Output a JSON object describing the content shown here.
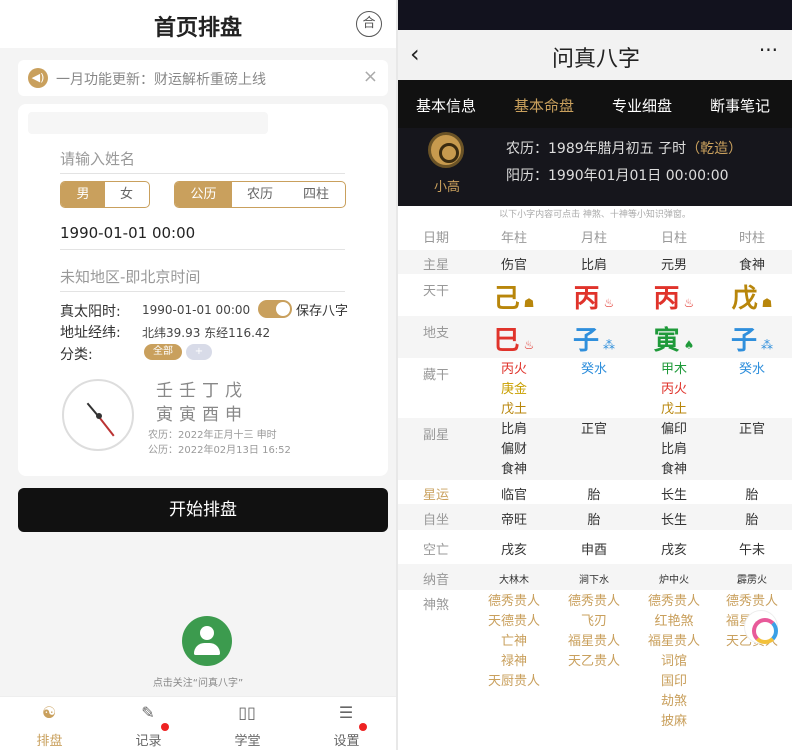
{
  "left": {
    "header": {
      "title": "首页排盘",
      "right_icon": "合"
    },
    "notice": {
      "icon": "speaker-icon",
      "text": "一月功能更新：财运解析重磅上线",
      "close": "×"
    },
    "form": {
      "name_placeholder": "请输入姓名",
      "gender": [
        "男",
        "女"
      ],
      "calendar": [
        "公历",
        "农历",
        "四柱"
      ],
      "datetime": "1990-01-01 00:00",
      "location_placeholder": "未知地区-即北京时间",
      "solar_time_label": "真太阳时:",
      "solar_time_value": "1990-01-01 00:00",
      "save_label": "保存八字",
      "coords_label": "地址经纬:",
      "coords_value": "北纬39.93 东经116.42",
      "category_label": "分类:",
      "category_all": "全部",
      "category_add": "+"
    },
    "preview": {
      "stems": "壬壬丁戊",
      "branches": "寅寅酉申",
      "lunar": "农历：2022年正月十三 申时",
      "solar": "公历：2022年02月13日 16:52"
    },
    "start_button": "开始排盘",
    "follow_text": "点击关注“问真八字”",
    "tabs": [
      {
        "label": "排盘",
        "icon": "yinyang-icon"
      },
      {
        "label": "记录",
        "icon": "note-icon"
      },
      {
        "label": "学堂",
        "icon": "book-icon"
      },
      {
        "label": "设置",
        "icon": "settings-icon"
      }
    ]
  },
  "right": {
    "nav": {
      "back": "‹",
      "title": "问真八字",
      "more": "···"
    },
    "tabs": [
      "基本信息",
      "基本命盘",
      "专业细盘",
      "断事笔记"
    ],
    "profile": {
      "name": "小高",
      "lunar": "农历：1989年腊月初五 子时",
      "qianzao": "（乾造）",
      "solar": "阳历：1990年01月01日 00:00:00"
    },
    "hint": "以下小字内容可点击 神煞、十神等小知识弹窗。",
    "headers": [
      "日期",
      "年柱",
      "月柱",
      "日柱",
      "时柱"
    ],
    "zhuxing": {
      "label": "主星",
      "values": [
        "伤官",
        "比肩",
        "元男",
        "食神"
      ]
    },
    "tiangan": {
      "label": "天干",
      "chars": [
        "己",
        "丙",
        "丙",
        "戊"
      ],
      "marks": [
        "☗",
        "♨",
        "♨",
        "☗"
      ]
    },
    "dizhi": {
      "label": "地支",
      "chars": [
        "巳",
        "子",
        "寅",
        "子"
      ],
      "marks": [
        "♨",
        "⁂",
        "♠",
        "⁂"
      ]
    },
    "canggan": {
      "label": "藏干",
      "cells": [
        [
          "丙火",
          "庚金",
          "戊土"
        ],
        [
          "癸水"
        ],
        [
          "甲木",
          "丙火",
          "戊土"
        ],
        [
          "癸水"
        ]
      ]
    },
    "fuxing": {
      "label": "副星",
      "cells": [
        [
          "比肩",
          "偏财",
          "食神"
        ],
        [
          "正官"
        ],
        [
          "偏印",
          "比肩",
          "食神"
        ],
        [
          "正官"
        ]
      ]
    },
    "xingyun": {
      "label": "星运",
      "values": [
        "临官",
        "胎",
        "长生",
        "胎"
      ]
    },
    "zizuo": {
      "label": "自坐",
      "values": [
        "帝旺",
        "胎",
        "长生",
        "胎"
      ]
    },
    "kongwang": {
      "label": "空亡",
      "values": [
        "戌亥",
        "申酉",
        "戌亥",
        "午未"
      ]
    },
    "nayin": {
      "label": "纳音",
      "values": [
        "大林木",
        "涧下水",
        "炉中火",
        "霹雳火"
      ]
    },
    "shensha": {
      "label": "神煞",
      "cells": [
        [
          "德秀贵人",
          "天德贵人",
          "亡神",
          "禄神",
          "天厨贵人"
        ],
        [
          "德秀贵人",
          "飞刃",
          "福星贵人",
          "天乙贵人"
        ],
        [
          "德秀贵人",
          "红艳煞",
          "福星贵人",
          "词馆",
          "国印",
          "劫煞",
          "披麻"
        ],
        [
          "德秀贵人",
          "福星贵人",
          "天乙贵人"
        ]
      ]
    },
    "colors": {
      "accent": "#c9a05d",
      "fire": "#e0332b",
      "water": "#2f8fdc",
      "wood": "#1f9a3a",
      "earth": "#b8860b"
    }
  }
}
